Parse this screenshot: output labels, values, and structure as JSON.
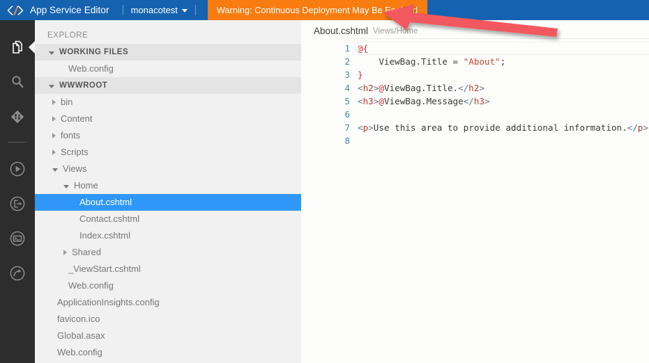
{
  "titlebar": {
    "logo_icon": "code-slash-pencil-logo",
    "brand": "App Service Editor",
    "separator": "|",
    "site_name": "monacotest",
    "site_caret_icon": "chevron-down-icon",
    "warning": "Warning: Continuous Deployment May Be Enabled",
    "colors": {
      "bar": "#1563b0",
      "warning_bg": "#f97c10",
      "accent": "#2f97f7"
    }
  },
  "activity_bar": {
    "items": [
      {
        "name": "explorer",
        "icon": "files-icon",
        "active": true
      },
      {
        "name": "search",
        "icon": "search-icon",
        "active": false
      },
      {
        "name": "source-control",
        "icon": "git-icon",
        "active": false
      },
      {
        "name": "run",
        "icon": "play-circle-icon",
        "active": false
      },
      {
        "name": "open-site",
        "icon": "open-external-circle-icon",
        "active": false
      },
      {
        "name": "console",
        "icon": "console-circle-icon",
        "active": false
      },
      {
        "name": "restart",
        "icon": "refresh-circle-icon",
        "active": false
      }
    ]
  },
  "sidebar": {
    "explore_label": "EXPLORE",
    "sections": [
      {
        "title": "WORKING FILES",
        "state": "expanded",
        "items": [
          {
            "label": "Web.config",
            "type": "file",
            "indent": 2,
            "state": "none",
            "selected": false
          }
        ]
      },
      {
        "title": "WWWROOT",
        "state": "expanded",
        "items": [
          {
            "label": "bin",
            "type": "folder",
            "indent": 1,
            "state": "collapsed",
            "selected": false
          },
          {
            "label": "Content",
            "type": "folder",
            "indent": 1,
            "state": "collapsed",
            "selected": false
          },
          {
            "label": "fonts",
            "type": "folder",
            "indent": 1,
            "state": "collapsed",
            "selected": false
          },
          {
            "label": "Scripts",
            "type": "folder",
            "indent": 1,
            "state": "collapsed",
            "selected": false
          },
          {
            "label": "Views",
            "type": "folder",
            "indent": 1,
            "state": "expanded",
            "selected": false
          },
          {
            "label": "Home",
            "type": "folder",
            "indent": 2,
            "state": "expanded",
            "selected": false
          },
          {
            "label": "About.cshtml",
            "type": "file",
            "indent": 3,
            "state": "none",
            "selected": true
          },
          {
            "label": "Contact.cshtml",
            "type": "file",
            "indent": 3,
            "state": "none",
            "selected": false
          },
          {
            "label": "Index.cshtml",
            "type": "file",
            "indent": 3,
            "state": "none",
            "selected": false
          },
          {
            "label": "Shared",
            "type": "folder",
            "indent": 2,
            "state": "collapsed",
            "selected": false
          },
          {
            "label": "_ViewStart.cshtml",
            "type": "file",
            "indent": 2,
            "state": "none",
            "selected": false
          },
          {
            "label": "Web.config",
            "type": "file",
            "indent": 2,
            "state": "none",
            "selected": false
          },
          {
            "label": "ApplicationInsights.config",
            "type": "file",
            "indent": 1,
            "state": "none",
            "selected": false
          },
          {
            "label": "favicon.ico",
            "type": "file",
            "indent": 1,
            "state": "none",
            "selected": false
          },
          {
            "label": "Global.asax",
            "type": "file",
            "indent": 1,
            "state": "none",
            "selected": false
          },
          {
            "label": "Web.config",
            "type": "file",
            "indent": 1,
            "state": "none",
            "selected": false
          }
        ]
      }
    ]
  },
  "editor": {
    "tab_title": "About.cshtml",
    "tab_path": "Views/Home",
    "lines": [
      {
        "num": "1",
        "tokens": [
          {
            "t": "@{",
            "c": "tk-at"
          }
        ]
      },
      {
        "num": "2",
        "tokens": [
          {
            "t": "    ViewBag.Title = ",
            "c": "tk-plain"
          },
          {
            "t": "\"About\"",
            "c": "tk-str"
          },
          {
            "t": ";",
            "c": "tk-plain"
          }
        ]
      },
      {
        "num": "3",
        "tokens": [
          {
            "t": "}",
            "c": "tk-brace"
          }
        ]
      },
      {
        "num": "4",
        "tokens": [
          {
            "t": "<",
            "c": "tk-br"
          },
          {
            "t": "h2",
            "c": "tk-tag"
          },
          {
            "t": ">",
            "c": "tk-br"
          },
          {
            "t": "@",
            "c": "tk-at"
          },
          {
            "t": "ViewBag.Title.",
            "c": "tk-plain"
          },
          {
            "t": "</",
            "c": "tk-br"
          },
          {
            "t": "h2",
            "c": "tk-tag"
          },
          {
            "t": ">",
            "c": "tk-br"
          }
        ]
      },
      {
        "num": "5",
        "tokens": [
          {
            "t": "<",
            "c": "tk-br"
          },
          {
            "t": "h3",
            "c": "tk-tag"
          },
          {
            "t": ">",
            "c": "tk-br"
          },
          {
            "t": "@",
            "c": "tk-at"
          },
          {
            "t": "ViewBag.Message",
            "c": "tk-plain"
          },
          {
            "t": "</",
            "c": "tk-br"
          },
          {
            "t": "h3",
            "c": "tk-tag"
          },
          {
            "t": ">",
            "c": "tk-br"
          }
        ]
      },
      {
        "num": "6",
        "tokens": []
      },
      {
        "num": "7",
        "tokens": [
          {
            "t": "<",
            "c": "tk-br"
          },
          {
            "t": "p",
            "c": "tk-tag"
          },
          {
            "t": ">",
            "c": "tk-br"
          },
          {
            "t": "Use this area to provide additional information.",
            "c": "tk-plain"
          },
          {
            "t": "</",
            "c": "tk-br"
          },
          {
            "t": "p",
            "c": "tk-tag"
          },
          {
            "t": ">",
            "c": "tk-br"
          }
        ]
      },
      {
        "num": "8",
        "tokens": []
      }
    ]
  },
  "annotation": {
    "arrow_icon": "left-pointing-arrow-annotation",
    "color": "#f2585e"
  }
}
